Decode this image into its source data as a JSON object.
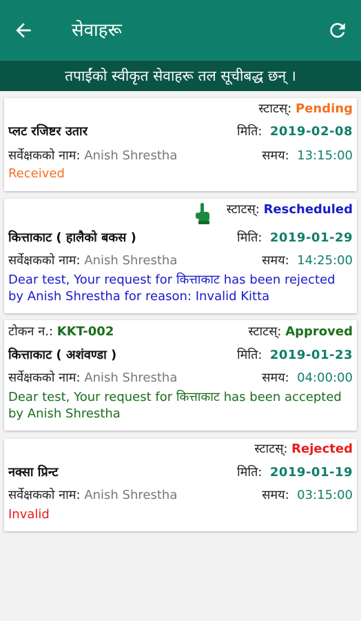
{
  "toolbar": {
    "title": "सेवाहरू"
  },
  "subheader": {
    "text": "तपाईंको स्वीकृत सेवाहरू तल सूचीबद्ध छन् ।"
  },
  "labels": {
    "status": "स्टाटस्:",
    "date": "मिति:",
    "surveyor": "सर्वेक्षकको नाम:",
    "time": "समय:",
    "token": "टोकन न.:"
  },
  "colors": {
    "toolbar": "#0f7f6b",
    "subheader": "#0a5445",
    "pending": "#f37021",
    "rescheduled": "#1a1acc",
    "approved": "#1c6e1c",
    "rejected": "#e81c1c",
    "date": "#0f7f6b"
  },
  "cards": [
    {
      "status": "Pending",
      "service": "प्लट रजिष्टर उतार",
      "date": "2019-02-08",
      "surveyor": "Anish Shrestha",
      "time": "13:15:00",
      "message": "Received"
    },
    {
      "status": "Rescheduled",
      "icon": "hand-pointer-icon",
      "service": "कित्ताकाट ( हालैको बकस )",
      "date": "2019-01-29",
      "surveyor": "Anish Shrestha",
      "time": "14:25:00",
      "message": "Dear test, Your request for कित्ताकाट has been rejected by Anish Shrestha for reason: Invalid Kitta"
    },
    {
      "token": "KKT-002",
      "status": "Approved",
      "service": "कित्ताकाट ( अशंवण्डा )",
      "date": "2019-01-23",
      "surveyor": "Anish Shrestha",
      "time": "04:00:00",
      "message": "Dear test, Your request for कित्ताकाट has been accepted by Anish Shrestha"
    },
    {
      "status": "Rejected",
      "service": "नक्सा प्रिन्ट",
      "date": "2019-01-19",
      "surveyor": "Anish Shrestha",
      "time": "03:15:00",
      "message": "Invalid"
    }
  ]
}
